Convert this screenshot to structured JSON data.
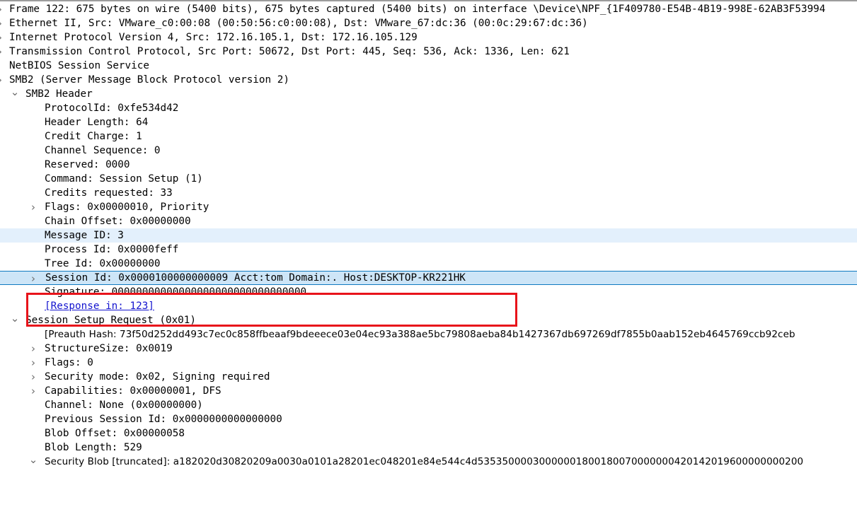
{
  "app": {
    "pane": "packet-details",
    "colors": {
      "selection_fill": "#cde5f7",
      "selection_border": "#0f7ac0",
      "related_fill": "#e3f0fc",
      "annotation_red": "#e8131a",
      "link_blue": "#1414cf"
    }
  },
  "tree": [
    {
      "id": "frame",
      "depth": 0,
      "twisty": "closed",
      "text": "Frame 122: 675 bytes on wire (5400 bits), 675 bytes captured (5400 bits) on interface \\Device\\NPF_{1F409780-E54B-4B19-998E-62AB3F53994"
    },
    {
      "id": "ethernet",
      "depth": 0,
      "twisty": "closed",
      "text": "Ethernet II, Src: VMware_c0:00:08 (00:50:56:c0:00:08), Dst: VMware_67:dc:36 (00:0c:29:67:dc:36)"
    },
    {
      "id": "ipv4",
      "depth": 0,
      "twisty": "closed",
      "text": "Internet Protocol Version 4, Src: 172.16.105.1, Dst: 172.16.105.129"
    },
    {
      "id": "tcp",
      "depth": 0,
      "twisty": "closed",
      "text": "Transmission Control Protocol, Src Port: 50672, Dst Port: 445, Seq: 536, Ack: 1336, Len: 621"
    },
    {
      "id": "netbios",
      "depth": 0,
      "twisty": "none",
      "text": "NetBIOS Session Service"
    },
    {
      "id": "smb2",
      "depth": 0,
      "twisty": "closed",
      "text": "SMB2 (Server Message Block Protocol version 2)"
    },
    {
      "id": "smb2-header",
      "depth": 1,
      "twisty": "open",
      "text": "SMB2 Header"
    },
    {
      "id": "protocol-id",
      "depth": 2,
      "twisty": "none",
      "text": "ProtocolId: 0xfe534d42"
    },
    {
      "id": "header-length",
      "depth": 2,
      "twisty": "none",
      "text": "Header Length: 64"
    },
    {
      "id": "credit-charge",
      "depth": 2,
      "twisty": "none",
      "text": "Credit Charge: 1"
    },
    {
      "id": "channel-sequence",
      "depth": 2,
      "twisty": "none",
      "text": "Channel Sequence: 0"
    },
    {
      "id": "reserved",
      "depth": 2,
      "twisty": "none",
      "text": "Reserved: 0000"
    },
    {
      "id": "command",
      "depth": 2,
      "twisty": "none",
      "text": "Command: Session Setup (1)"
    },
    {
      "id": "credits-requested",
      "depth": 2,
      "twisty": "none",
      "text": "Credits requested: 33"
    },
    {
      "id": "flags-header",
      "depth": 2,
      "twisty": "closed",
      "text": "Flags: 0x00000010, Priority"
    },
    {
      "id": "chain-offset",
      "depth": 2,
      "twisty": "none",
      "text": "Chain Offset: 0x00000000"
    },
    {
      "id": "message-id",
      "depth": 2,
      "twisty": "none",
      "highlight": "light",
      "text": "Message ID: 3"
    },
    {
      "id": "process-id",
      "depth": 2,
      "twisty": "none",
      "text": "Process Id: 0x0000feff"
    },
    {
      "id": "tree-id",
      "depth": 2,
      "twisty": "none",
      "text": "Tree Id: 0x00000000"
    },
    {
      "id": "session-id",
      "depth": 2,
      "twisty": "closed",
      "highlight": "selected",
      "text": "Session Id: 0x0000100000000009 Acct:tom Domain:. Host:DESKTOP-KR221HK"
    },
    {
      "id": "signature",
      "depth": 2,
      "twisty": "none",
      "text": "Signature: 00000000000000000000000000000000"
    },
    {
      "id": "response-in",
      "depth": 2,
      "twisty": "none",
      "link": true,
      "text": "[Response in: 123]"
    },
    {
      "id": "session-setup-request",
      "depth": 1,
      "twisty": "open",
      "text": "Session Setup Request (0x01)"
    },
    {
      "id": "preauth-hash",
      "depth": 2,
      "twisty": "none",
      "prop": true,
      "text": "[Preauth Hash: 73f50d252dd493c7ec0c858ffbeaaf9bdeeece03e04ec93a388ae5bc79808aeba84b1427367db697269df7855b0aab152eb4645769ccb92ceb"
    },
    {
      "id": "structure-size",
      "depth": 2,
      "twisty": "closed",
      "text": "StructureSize: 0x0019"
    },
    {
      "id": "flags-request",
      "depth": 2,
      "twisty": "closed",
      "text": "Flags: 0"
    },
    {
      "id": "security-mode",
      "depth": 2,
      "twisty": "closed",
      "text": "Security mode: 0x02, Signing required"
    },
    {
      "id": "capabilities",
      "depth": 2,
      "twisty": "closed",
      "text": "Capabilities: 0x00000001, DFS"
    },
    {
      "id": "channel",
      "depth": 2,
      "twisty": "none",
      "text": "Channel: None (0x00000000)"
    },
    {
      "id": "previous-session-id",
      "depth": 2,
      "twisty": "none",
      "text": "Previous Session Id: 0x0000000000000000"
    },
    {
      "id": "blob-offset",
      "depth": 2,
      "twisty": "none",
      "text": "Blob Offset: 0x00000058"
    },
    {
      "id": "blob-length",
      "depth": 2,
      "twisty": "none",
      "text": "Blob Length: 529"
    },
    {
      "id": "security-blob",
      "depth": 2,
      "twisty": "open",
      "prop": true,
      "text": "Security Blob [truncated]: a182020d30820209a0030a0101a28201ec048201e84e544c4d53535000030000001800180070000000420142019600000000200"
    }
  ],
  "annotation": {
    "name": "session-id-callout",
    "shape": "rectangle",
    "color": "#e8131a"
  }
}
